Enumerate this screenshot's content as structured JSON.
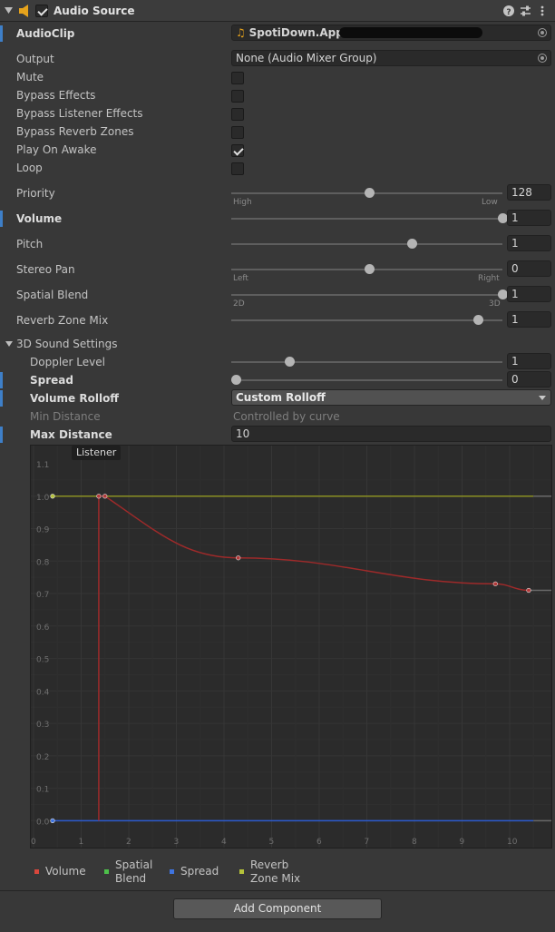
{
  "header": {
    "title": "Audio Source"
  },
  "audio_clip": {
    "label": "AudioClip",
    "value": "SpotiDown.App -"
  },
  "output": {
    "label": "Output",
    "value": "None (Audio Mixer Group)"
  },
  "toggles": [
    {
      "label": "Mute",
      "checked": false
    },
    {
      "label": "Bypass Effects",
      "checked": false
    },
    {
      "label": "Bypass Listener Effects",
      "checked": false
    },
    {
      "label": "Bypass Reverb Zones",
      "checked": false
    },
    {
      "label": "Play On Awake",
      "checked": true
    },
    {
      "label": "Loop",
      "checked": false
    }
  ],
  "sliders": {
    "priority": {
      "label": "Priority",
      "value": "128",
      "fraction": 0.5,
      "min_label": "High",
      "max_label": "Low"
    },
    "volume": {
      "label": "Volume",
      "value": "1",
      "fraction": 1.0
    },
    "pitch": {
      "label": "Pitch",
      "value": "1",
      "fraction": 0.66
    },
    "stereo_pan": {
      "label": "Stereo Pan",
      "value": "0",
      "fraction": 0.5,
      "min_label": "Left",
      "max_label": "Right"
    },
    "spatial_blend": {
      "label": "Spatial Blend",
      "value": "1",
      "fraction": 1.0,
      "min_label": "2D",
      "max_label": "3D"
    },
    "reverb_zone_mix": {
      "label": "Reverb Zone Mix",
      "value": "1",
      "fraction": 0.909
    }
  },
  "sound3d": {
    "foldout": "3D Sound Settings",
    "doppler": {
      "label": "Doppler Level",
      "value": "1",
      "fraction": 0.2
    },
    "spread": {
      "label": "Spread",
      "value": "0",
      "fraction": 0.0
    },
    "rolloff": {
      "label": "Volume Rolloff",
      "value": "Custom Rolloff"
    },
    "min_distance": {
      "label": "Min Distance",
      "value": "Controlled by curve"
    },
    "max_distance": {
      "label": "Max Distance",
      "value": "10"
    }
  },
  "curve": {
    "listener_label": "Listener",
    "y_ticks": [
      "1.1",
      "1.0",
      "0.9",
      "0.8",
      "0.7",
      "0.6",
      "0.5",
      "0.4",
      "0.3",
      "0.2",
      "0.1",
      "0.0"
    ],
    "x_ticks": [
      "0",
      "1",
      "2",
      "3",
      "4",
      "5",
      "6",
      "7",
      "8",
      "9",
      "10"
    ],
    "listener_distance": 1.37,
    "volume_keys": [
      [
        1.37,
        1.0
      ],
      [
        1.5,
        1.0
      ],
      [
        4.3,
        0.81
      ],
      [
        9.7,
        0.73
      ],
      [
        10.4,
        0.71
      ]
    ],
    "reverb_level": 1.0,
    "spread_level": 0.0
  },
  "legend": [
    {
      "label": "Volume",
      "color": "#d9473c"
    },
    {
      "label": "Spatial Blend",
      "color": "#4dc04a"
    },
    {
      "label": "Spread",
      "color": "#3f74e0"
    },
    {
      "label": "Reverb Zone Mix",
      "color": "#b5c23a"
    }
  ],
  "colors": {
    "volume_curve": "#9e2a2a",
    "reverb_curve": "#8a8f23",
    "spread_curve": "#2c5bd0",
    "accent": "#3e7fc8"
  },
  "footer": {
    "add_component": "Add Component"
  }
}
